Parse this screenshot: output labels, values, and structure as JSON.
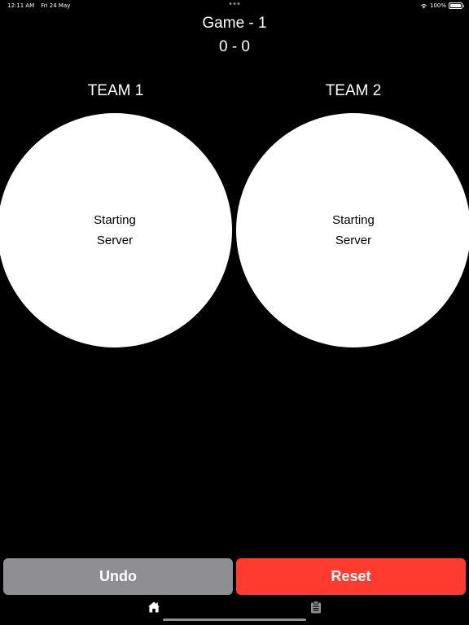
{
  "status_bar": {
    "time": "12:11 AM",
    "date": "Fri 24 May",
    "battery": "100%",
    "battery_level": 1.0
  },
  "header": {
    "game_title": "Game - 1",
    "score": "0 - 0"
  },
  "teams": [
    {
      "label": "TEAM 1",
      "circle_line1": "Starting",
      "circle_line2": "Server"
    },
    {
      "label": "TEAM 2",
      "circle_line1": "Starting",
      "circle_line2": "Server"
    }
  ],
  "buttons": {
    "undo_label": "Undo",
    "reset_label": "Reset"
  },
  "tabbar": {
    "items": [
      {
        "icon": "home-icon",
        "active": true
      },
      {
        "icon": "clipboard-icon",
        "active": false
      }
    ]
  },
  "colors": {
    "background": "#000000",
    "undo": "#8e8e93",
    "reset": "#ff3b30",
    "circle": "#ffffff"
  }
}
